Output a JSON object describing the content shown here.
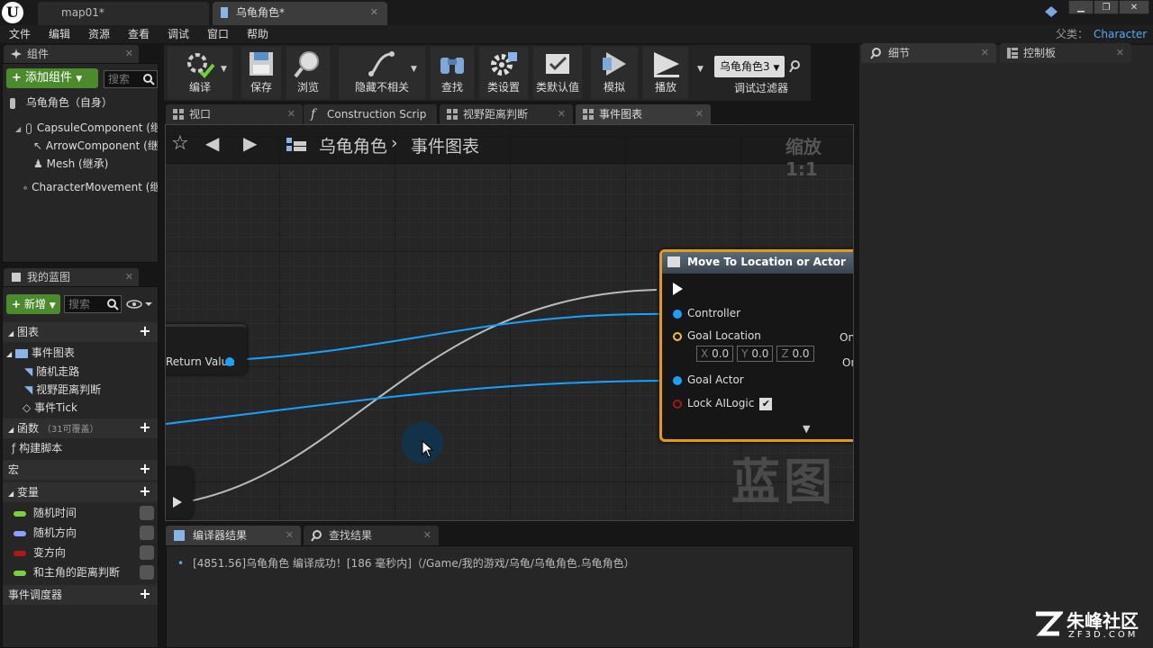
{
  "window": {
    "tabs": [
      {
        "label": "map01*"
      },
      {
        "label": "乌龟角色*"
      }
    ],
    "parent_label": "父类：",
    "parent_value": "Character"
  },
  "menu": [
    "文件",
    "编辑",
    "资源",
    "查看",
    "调试",
    "窗口",
    "帮助"
  ],
  "components": {
    "tab": "组件",
    "add_label": "添加组件",
    "search_placeholder": "搜索",
    "root": "乌龟角色（自身）",
    "items": [
      "CapsuleComponent (继承)",
      "ArrowComponent (继承)",
      "Mesh (继承)",
      "CharacterMovement (继承)"
    ]
  },
  "myblueprint": {
    "tab": "我的蓝图",
    "new_label": "新增",
    "search_placeholder": "搜索",
    "graphs_header": "图表",
    "event_graph": "事件图表",
    "graph_items": [
      "随机走路",
      "视野距离判断",
      "事件Tick"
    ],
    "functions_header": "函数",
    "functions_count": "（31可覆盖）",
    "function_items": [
      "构建脚本"
    ],
    "macros_header": "宏",
    "variables_header": "变量",
    "variables": [
      {
        "name": "随机时间",
        "color": "#7cd13a"
      },
      {
        "name": "随机方向",
        "color": "#8ea0ff"
      },
      {
        "name": "变方向",
        "color": "#b01818"
      },
      {
        "name": "和主角的距离判断",
        "color": "#7cd13a"
      }
    ],
    "dispatchers_header": "事件调度器"
  },
  "toolbar": {
    "items": [
      "编译",
      "保存",
      "浏览",
      "隐藏不相关",
      "查找",
      "类设置",
      "类默认值",
      "模拟",
      "播放"
    ],
    "debug_select": "乌龟角色3",
    "debug_label": "调试过滤器"
  },
  "graph_tabs": [
    "视口",
    "Construction Scrip",
    "视野距离判断",
    "事件图表"
  ],
  "breadcrumb": {
    "root": "乌龟角色",
    "current": "事件图表"
  },
  "zoom": "缩放1:1",
  "watermark": "蓝图",
  "node": {
    "title": "Move To Location or Actor",
    "pins": {
      "controller": "Controller",
      "goal_location": "Goal Location",
      "goal_actor": "Goal Actor",
      "lock": "Lock AILogic"
    },
    "x": "0.0",
    "y": "0.0",
    "z": "0.0",
    "x_label": "X",
    "y_label": "Y",
    "z_label": "Z",
    "out_1": "On",
    "out_2": "On"
  },
  "left_node": {
    "label": "Return Value"
  },
  "bottom_tabs": [
    "编译器结果",
    "查找结果"
  ],
  "log_line": "[4851.56]乌龟角色 编译成功！[186 毫秒内]（/Game/我的游戏/乌龟/乌龟角色.乌龟角色）",
  "right": {
    "details_tab": "细节",
    "palette_tab": "控制板"
  },
  "brand": {
    "cn": "朱峰社区",
    "url": "ZF3D.COM"
  }
}
